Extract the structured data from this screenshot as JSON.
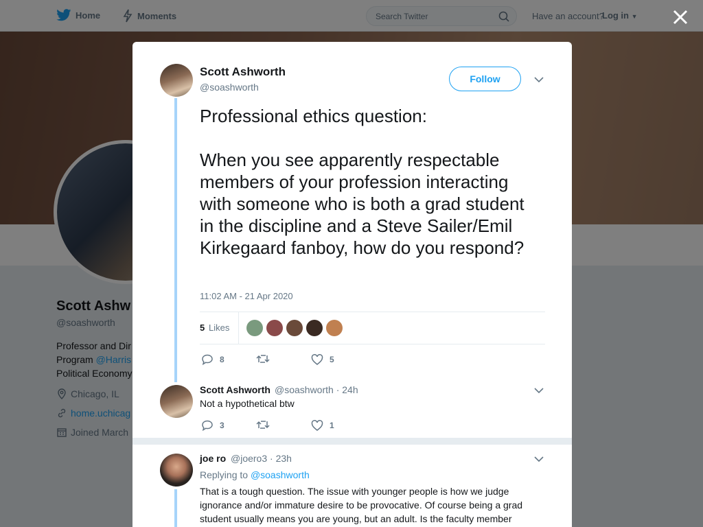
{
  "nav": {
    "home": "Home",
    "moments": "Moments",
    "search_placeholder": "Search Twitter",
    "have_account": "Have an account?",
    "login": "Log in"
  },
  "background_profile": {
    "name": "Scott Ashw",
    "handle": "@soashworth",
    "bio_line1": "Professor and Dir",
    "bio_line2_prefix": "Program ",
    "bio_line2_link": "@Harris",
    "bio_line3": "Political Economy",
    "location": "Chicago, IL",
    "website": "home.uchicag",
    "joined": "Joined March"
  },
  "tweet": {
    "name": "Scott Ashworth",
    "handle": "@soashworth",
    "follow": "Follow",
    "text": "Professional ethics question:\n\nWhen you see apparently respectable members of your profession interacting with someone who is both a grad student in the discipline and a Steve Sailer/Emil Kirkegaard fanboy, how do you respond?",
    "timestamp": "11:02 AM - 21 Apr 2020",
    "likes_count": "5",
    "likes_label": "Likes",
    "replies": "8",
    "retweets": "",
    "likes": "5",
    "liker_colors": [
      "#7a9a7e",
      "#8a4a4a",
      "#6a4a3a",
      "#3a2a22",
      "#c08050"
    ]
  },
  "reply1": {
    "name": "Scott Ashworth",
    "handle": "@soashworth",
    "time": "· 24h",
    "text": "Not a hypothetical btw",
    "replies": "3",
    "likes": "1"
  },
  "reply2": {
    "name": "joe ro",
    "handle": "@joero3",
    "time": "· 23h",
    "replying_prefix": "Replying to",
    "replying_to": "@soashworth",
    "text": "That is a tough question. The issue with younger people is how we judge ignorance and/or immature desire to be provocative. Of course being a grad student usually means you are young, but an adult. Is the faculty member"
  }
}
